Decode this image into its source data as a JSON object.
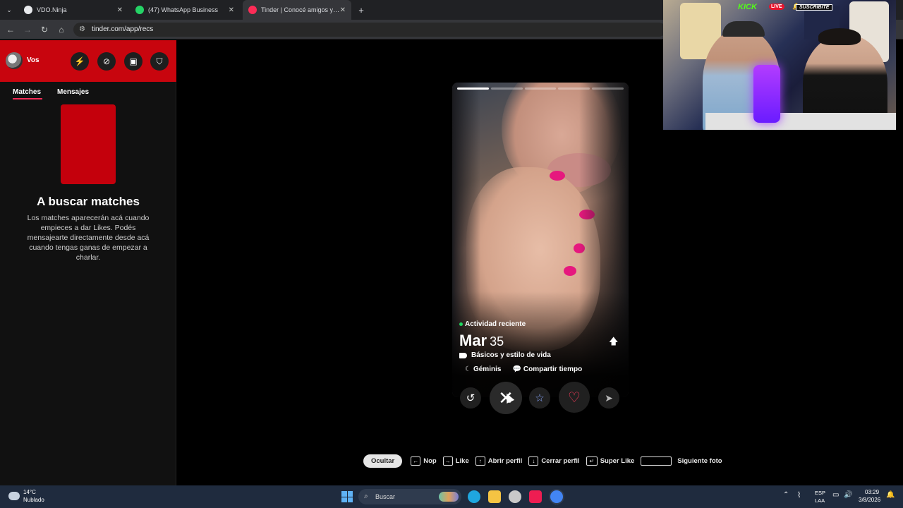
{
  "browser": {
    "tabs": [
      {
        "title": "VDO.Ninja",
        "favicon_color": "#e8eaed"
      },
      {
        "title": "(47) WhatsApp Business",
        "favicon_color": "#25d366"
      },
      {
        "title": "Tinder | Conocé amigos y gente",
        "favicon_color": "#fd2c57",
        "active": true
      }
    ],
    "close_glyph": "✕",
    "new_tab_glyph": "+",
    "tab_menu_glyph": "⌄",
    "url": "tinder.com/app/recs",
    "icons": {
      "back": "←",
      "forward": "→",
      "reload": "↻",
      "home": "⌂",
      "site_info": "⚙"
    }
  },
  "sidebar": {
    "user_name": "Vos",
    "header_icons": [
      {
        "name": "boost-icon",
        "glyph": "⚡"
      },
      {
        "name": "explore-icon",
        "glyph": "⊘"
      },
      {
        "name": "briefcase-icon",
        "glyph": "▣"
      },
      {
        "name": "shield-icon",
        "glyph": "⛉"
      }
    ],
    "tabs": {
      "matches": "Matches",
      "messages": "Mensajes"
    },
    "empty_title": "A buscar matches",
    "empty_desc": "Los matches aparecerán acá cuando empieces a dar Likes. Podés mensajearte directamente desde acá cuando tengas ganas de empezar a charlar.",
    "accent_color": "#c8050e"
  },
  "profile": {
    "photo_count": 5,
    "active_photo": 1,
    "activity": "Actividad reciente",
    "name": "Mar",
    "age": "35",
    "basics_label": "Básicos y estilo de vida",
    "chips": [
      {
        "icon": "☾",
        "label": "Géminis"
      },
      {
        "icon": "💬",
        "label": "Compartir tiempo"
      }
    ],
    "info_glyph": "🡅"
  },
  "actions": {
    "rewind": "↺",
    "nope": "✕",
    "super_like": "☆",
    "like": "♡",
    "boost": "➤"
  },
  "hints": {
    "hide": "Ocultar",
    "items": [
      {
        "key": "←",
        "label": "Nop"
      },
      {
        "key": "→",
        "label": "Like"
      },
      {
        "key": "↑",
        "label": "Abrir perfil"
      },
      {
        "key": "↓",
        "label": "Cerrar perfil"
      },
      {
        "key": "↵",
        "label": "Super Like"
      },
      {
        "key": "",
        "label": "Siguiente foto"
      }
    ]
  },
  "stream": {
    "platform": "KICK",
    "live": "LIVE",
    "subscribe": "SUSCRIBITE",
    "bell": "🔔"
  },
  "taskbar": {
    "temp": "14°C",
    "weather": "Nublado",
    "search": "Buscar",
    "apps": [
      {
        "name": "edge-app",
        "color": "#1fa6df"
      },
      {
        "name": "explorer-app",
        "color": "#f5c443"
      },
      {
        "name": "app-circle",
        "color": "#c9c9c9"
      },
      {
        "name": "tiktok-app",
        "color": "#ee1d52"
      },
      {
        "name": "chrome-app",
        "color": "#4285f4"
      }
    ],
    "lang1": "ESP",
    "lang2": "LAA",
    "time": "03:29",
    "date": "3/8/2026",
    "tray": {
      "up": "⌃",
      "network": "⌇",
      "monitor": "▭",
      "volume": "🔊",
      "bell": "🔔"
    }
  }
}
